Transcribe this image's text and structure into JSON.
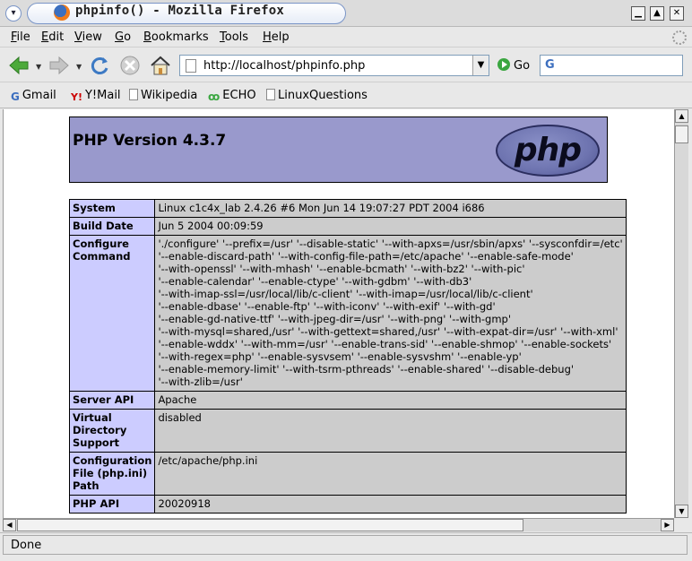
{
  "window": {
    "title": "phpinfo() - Mozilla Firefox",
    "wm_buttons": [
      "minimize",
      "maximize",
      "close"
    ]
  },
  "menubar": {
    "items": [
      {
        "label": "File"
      },
      {
        "label": "Edit"
      },
      {
        "label": "View"
      },
      {
        "label": "Go"
      },
      {
        "label": "Bookmarks"
      },
      {
        "label": "Tools"
      },
      {
        "label": "Help"
      }
    ]
  },
  "navigation": {
    "url": "http://localhost/phpinfo.php",
    "go_label": "Go",
    "search_engine": "G"
  },
  "bookmarks": [
    {
      "label": "Gmail",
      "icon": "G"
    },
    {
      "label": "Y!Mail",
      "icon": "Y!"
    },
    {
      "label": "Wikipedia",
      "icon": "doc"
    },
    {
      "label": "ECHO",
      "icon": "echo"
    },
    {
      "label": "LinuxQuestions",
      "icon": "doc"
    }
  ],
  "page": {
    "header_title": "PHP Version 4.3.7",
    "logo_text": "php",
    "rows": {
      "system": {
        "key": "System",
        "value": "Linux c1c4x_lab 2.4.26 #6 Mon Jun 14 19:07:27 PDT 2004 i686"
      },
      "build_date": {
        "key": "Build Date",
        "value": "Jun 5 2004 00:09:59"
      },
      "configure": {
        "key": "Configure Command",
        "lines": [
          "'./configure' '--prefix=/usr' '--disable-static' '--with-apxs=/usr/sbin/apxs' '--sysconfdir=/etc'",
          "'--enable-discard-path' '--with-config-file-path=/etc/apache' '--enable-safe-mode'",
          "'--with-openssl' '--with-mhash' '--enable-bcmath' '--with-bz2' '--with-pic'",
          "'--enable-calendar' '--enable-ctype' '--with-gdbm' '--with-db3'",
          "'--with-imap-ssl=/usr/local/lib/c-client' '--with-imap=/usr/local/lib/c-client'",
          "'--enable-dbase' '--enable-ftp' '--with-iconv' '--with-exif' '--with-gd'",
          "'--enable-gd-native-ttf' '--with-jpeg-dir=/usr' '--with-png' '--with-gmp'",
          "'--with-mysql=shared,/usr' '--with-gettext=shared,/usr' '--with-expat-dir=/usr' '--with-xml'",
          "'--enable-wddx' '--with-mm=/usr' '--enable-trans-sid' '--enable-shmop' '--enable-sockets'",
          "'--with-regex=php' '--enable-sysvsem' '--enable-sysvshm' '--enable-yp'",
          "'--enable-memory-limit' '--with-tsrm-pthreads' '--enable-shared' '--disable-debug'",
          "'--with-zlib=/usr'"
        ]
      },
      "server_api": {
        "key": "Server API",
        "value": "Apache"
      },
      "virtual_dir": {
        "key_lines": [
          "Virtual",
          "Directory",
          "Support"
        ],
        "value": "disabled"
      },
      "config_file": {
        "key_lines": [
          "Configuration",
          "File (php.ini)",
          "Path"
        ],
        "value": "/etc/apache/php.ini"
      },
      "php_api": {
        "key": "PHP API",
        "value": "20020918"
      }
    }
  },
  "status": {
    "text": "Done"
  }
}
